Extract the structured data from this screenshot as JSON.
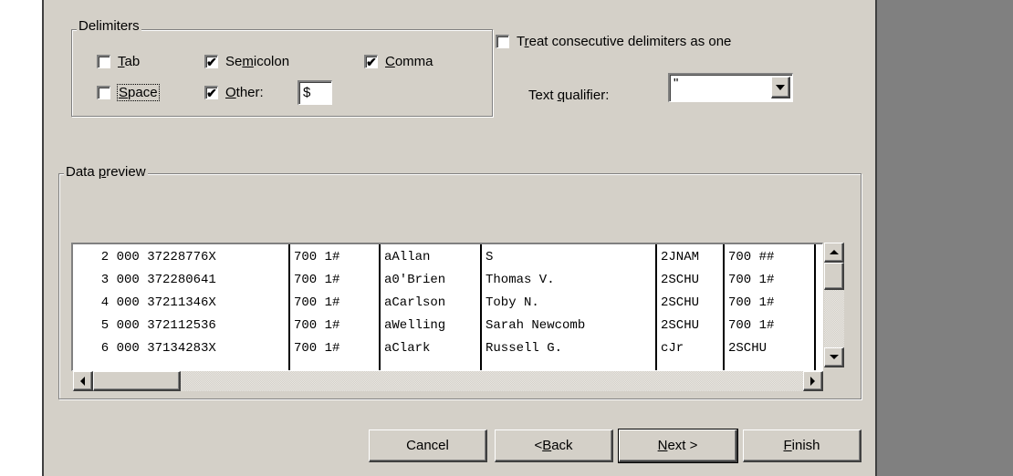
{
  "delimiters": {
    "group_label": "Delimiters",
    "tab": {
      "label_pre": "",
      "label_mn": "T",
      "label_post": "ab",
      "checked": false
    },
    "semicolon": {
      "label_pre": "Se",
      "label_mn": "m",
      "label_post": "icolon",
      "checked": true
    },
    "comma": {
      "label_pre": "",
      "label_mn": "C",
      "label_post": "omma",
      "checked": true
    },
    "space": {
      "label_pre": "",
      "label_mn": "S",
      "label_post": "pace",
      "checked": false
    },
    "other": {
      "label_pre": "",
      "label_mn": "O",
      "label_post": "ther:",
      "checked": true,
      "value": "$"
    }
  },
  "consecutive": {
    "label_pre": "T",
    "label_mn": "r",
    "label_post": "eat consecutive delimiters as one",
    "checked": false
  },
  "qualifier": {
    "label_pre": "Text ",
    "label_mn": "q",
    "label_post": "ualifier:",
    "value": "\""
  },
  "preview": {
    "group_label_pre": "Data ",
    "group_label_mn": "p",
    "group_label_post": "review",
    "rows": [
      {
        "c1": "  2 000 37228776X",
        "c2": "700 1#",
        "c3": "aAllan",
        "c4": "S",
        "c5": "2JNAM",
        "c6": "700 ##"
      },
      {
        "c1": "  3 000 372280641",
        "c2": "700 1#",
        "c3": "a0'Brien",
        "c4": "Thomas V.",
        "c5": "2SCHU",
        "c6": "700 1#"
      },
      {
        "c1": "  4 000 37211346X",
        "c2": "700 1#",
        "c3": "aCarlson",
        "c4": "Toby N.",
        "c5": "2SCHU",
        "c6": "700 1#"
      },
      {
        "c1": "  5 000 372112536",
        "c2": "700 1#",
        "c3": "aWelling",
        "c4": "Sarah Newcomb",
        "c5": "2SCHU",
        "c6": "700 1#"
      },
      {
        "c1": "  6 000 37134283X",
        "c2": "700 1#",
        "c3": "aClark",
        "c4": "Russell G.",
        "c5": "cJr",
        "c6": "2SCHU"
      }
    ]
  },
  "buttons": {
    "cancel": {
      "pre": "Cancel",
      "mn": "",
      "post": ""
    },
    "back": {
      "pre": "< ",
      "mn": "B",
      "post": "ack"
    },
    "next": {
      "pre": "",
      "mn": "N",
      "post": "ext >"
    },
    "finish": {
      "pre": "",
      "mn": "F",
      "post": "inish"
    }
  },
  "icons": {
    "check": "✔",
    "checkbox_check": "checkmark-glyph"
  }
}
